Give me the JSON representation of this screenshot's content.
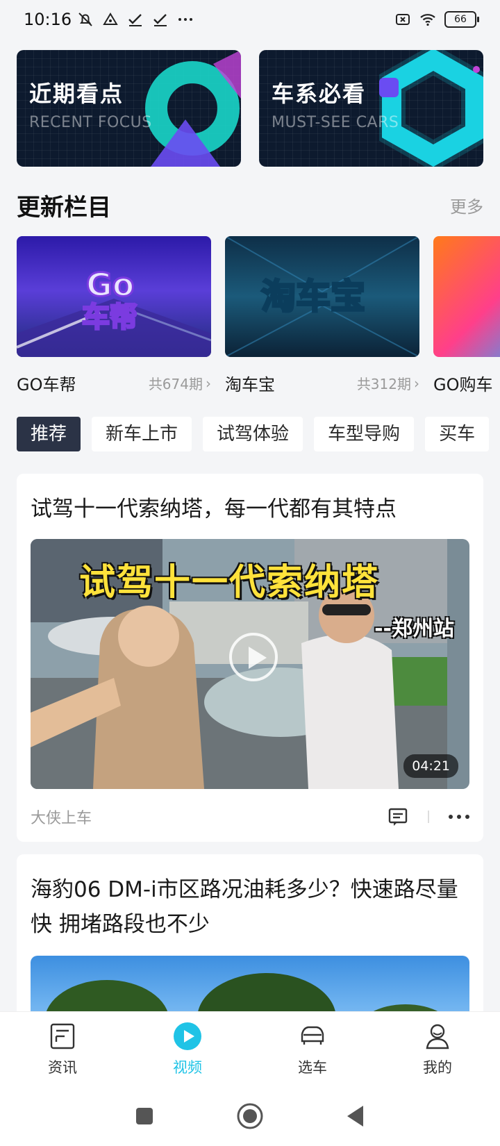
{
  "status_bar": {
    "time": "10:16",
    "battery": "66",
    "left_icons": [
      "mute-icon",
      "notification-icon",
      "check-icon",
      "check-icon",
      "more-icon"
    ],
    "right_icons": [
      "no-sim-icon",
      "wifi-icon",
      "battery-icon"
    ]
  },
  "features": [
    {
      "title": "近期看点",
      "subtitle": "RECENT FOCUS"
    },
    {
      "title": "车系必看",
      "subtitle": "MUST-SEE CARS"
    }
  ],
  "update_section": {
    "title": "更新栏目",
    "more": "更多",
    "columns": [
      {
        "name": "GO车帮",
        "count": "共674期"
      },
      {
        "name": "淘车宝",
        "count": "共312期"
      },
      {
        "name": "GO购车",
        "count": ""
      }
    ]
  },
  "categories": [
    "推荐",
    "新车上市",
    "试驾体验",
    "车型导购",
    "买车"
  ],
  "feed": [
    {
      "title": "试驾十一代索纳塔，每一代都有其特点",
      "overlay_title": "试驾十一代索纳塔",
      "overlay_sub": "--郑州站",
      "duration": "04:21",
      "author": "大侠上车"
    },
    {
      "title": "海豹06 DM-i市区路况油耗多少？快速路尽量快 拥堵路段也不少"
    }
  ],
  "bottom_nav": [
    {
      "label": "资讯",
      "icon": "news-icon"
    },
    {
      "label": "视频",
      "icon": "play-icon",
      "active": true
    },
    {
      "label": "选车",
      "icon": "car-icon"
    },
    {
      "label": "我的",
      "icon": "user-icon"
    }
  ],
  "colors": {
    "accent": "#1fc3e6",
    "active_tab": "#2b3346",
    "background": "#f4f5f7"
  }
}
